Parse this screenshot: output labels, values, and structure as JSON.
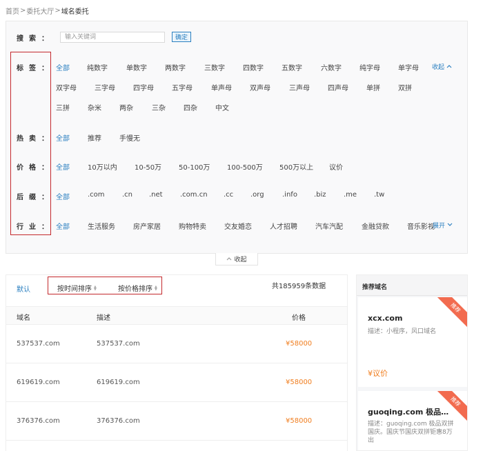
{
  "breadcrumb": {
    "items": [
      "首页",
      "委托大厅",
      "域名委托"
    ],
    "separator": ">"
  },
  "search": {
    "label_chars": [
      "搜",
      "索",
      "："
    ],
    "placeholder": "输入关键词",
    "value": "",
    "confirm_label": "确定"
  },
  "filters": {
    "tags": {
      "label_chars": [
        "标",
        "签",
        "："
      ],
      "options": [
        "全部",
        "纯数字",
        "单数字",
        "两数字",
        "三数字",
        "四数字",
        "五数字",
        "六数字",
        "纯字母",
        "单字母",
        "双字母",
        "三字母",
        "四字母",
        "五字母",
        "单声母",
        "双声母",
        "三声母",
        "四声母",
        "单拼",
        "双拼",
        "三拼",
        "杂米",
        "两杂",
        "三杂",
        "四杂",
        "中文"
      ],
      "toggle_label": "收起"
    },
    "hot": {
      "label_chars": [
        "热",
        "卖",
        "："
      ],
      "options": [
        "全部",
        "推荐",
        "手慢无"
      ]
    },
    "price": {
      "label_chars": [
        "价",
        "格",
        "："
      ],
      "options": [
        "全部",
        "10万以内",
        "10-50万",
        "50-100万",
        "100-500万",
        "500万以上",
        "议价"
      ]
    },
    "suffix": {
      "label_chars": [
        "后",
        "缀",
        "："
      ],
      "options": [
        "全部",
        ".com",
        ".cn",
        ".net",
        ".com.cn",
        ".cc",
        ".org",
        ".info",
        ".biz",
        ".me",
        ".tw"
      ]
    },
    "industry": {
      "label_chars": [
        "行",
        "业",
        "："
      ],
      "options": [
        "全部",
        "生活服务",
        "房产家居",
        "购物特卖",
        "交友婚恋",
        "人才招聘",
        "汽车汽配",
        "金融贷款",
        "音乐影视"
      ],
      "toggle_label": "展开"
    }
  },
  "collapse_label": "收起",
  "list": {
    "sort_default": "默认",
    "sort_time": "按时间排序",
    "sort_price": "按价格排序",
    "total": "共185959条数据",
    "columns": [
      "域名",
      "描述",
      "价格"
    ],
    "rows": [
      {
        "domain": "537537.com",
        "desc": "537537.com",
        "price": "¥58000"
      },
      {
        "domain": "619619.com",
        "desc": "619619.com",
        "price": "¥58000"
      },
      {
        "domain": "376376.com",
        "desc": "376376.com",
        "price": "¥58000"
      }
    ]
  },
  "recommend": {
    "title": "推荐域名",
    "ribbon": "推荐",
    "cards": [
      {
        "domain": "xcx.com",
        "desc": "描述：小程序，风口域名",
        "price": "¥议价"
      },
      {
        "domain": "guoqing.com 极品双...",
        "desc": "描述：guoqing.com 极品双拼 国庆。国庆节国庆双拼钜惠8万出",
        "price": ""
      }
    ]
  },
  "colors": {
    "accent": "#2a7fc0",
    "price": "#f07d1e",
    "highlight": "#c3272b",
    "ribbon": "#f26b4f"
  }
}
